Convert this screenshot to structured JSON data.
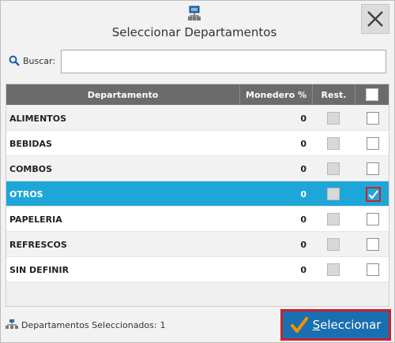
{
  "window": {
    "title": "Seleccionar Departamentos"
  },
  "search": {
    "label": "Buscar:",
    "value": "",
    "placeholder": ""
  },
  "grid": {
    "columns": [
      "Departamento",
      "Monedero %",
      "Rest."
    ],
    "rows": [
      {
        "name": "ALIMENTOS",
        "pct": "0",
        "selected": false
      },
      {
        "name": "BEBIDAS",
        "pct": "0",
        "selected": false
      },
      {
        "name": "COMBOS",
        "pct": "0",
        "selected": false
      },
      {
        "name": "OTROS",
        "pct": "0",
        "selected": true
      },
      {
        "name": "PAPELERIA",
        "pct": "0",
        "selected": false
      },
      {
        "name": "REFRESCOS",
        "pct": "0",
        "selected": false
      },
      {
        "name": "SIN DEFINIR",
        "pct": "0",
        "selected": false
      }
    ]
  },
  "footer": {
    "selected_label": "Departamentos Seleccionados:",
    "selected_count": "1",
    "select_button_first": "S",
    "select_button_rest": "eleccionar"
  },
  "colors": {
    "accent_blue": "#1fa6d8",
    "button_blue": "#1a6fb0",
    "highlight_red": "#c8232c",
    "check_orange": "#f39200"
  },
  "icons": {
    "title": "network-icon",
    "close": "close-icon",
    "search": "magnifier-icon",
    "footer": "network-icon",
    "button": "checkmark-icon"
  }
}
